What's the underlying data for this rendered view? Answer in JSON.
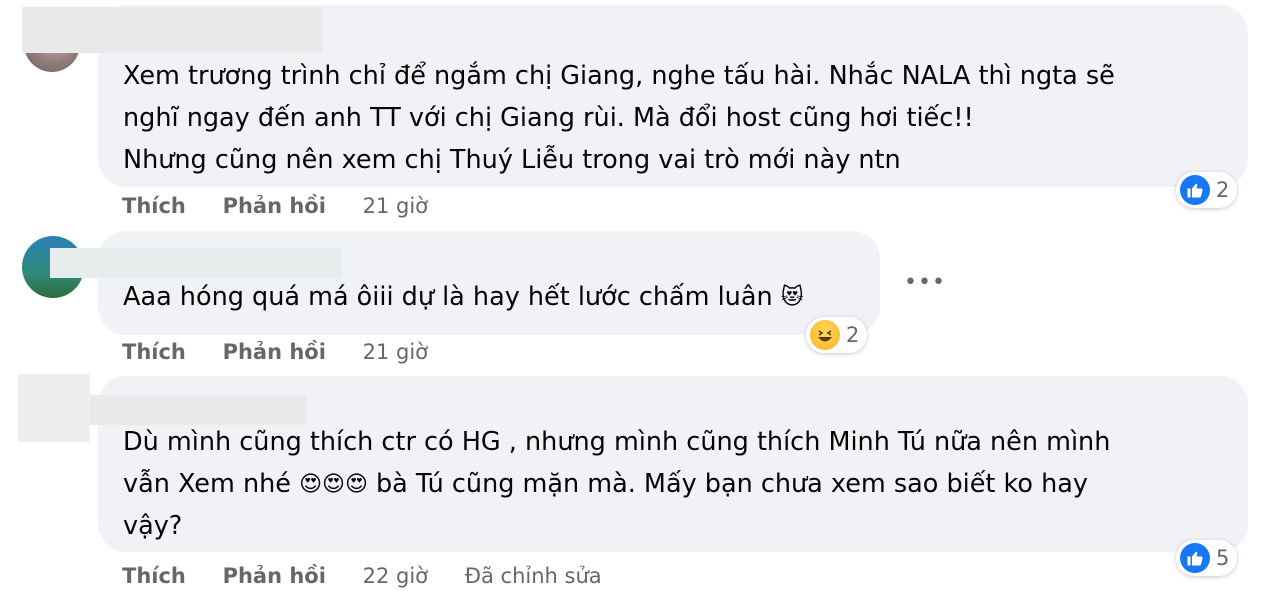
{
  "comments": [
    {
      "lines": [
        "Xem trương trình chỉ để ngắm chị Giang, nghe tấu hài. Nhắc NALA thì ngta sẽ",
        "nghĩ ngay đến anh TT với chị Giang rùi. Mà đổi host cũng hơi tiếc!!",
        "Nhưng cũng nên xem chị Thuý Liễu trong vai trò mới này ntn"
      ],
      "actions": {
        "like": "Thích",
        "reply": "Phản hồi",
        "time": "21 giờ"
      },
      "reaction": {
        "icon": "like-icon",
        "count": "2"
      }
    },
    {
      "lines": [
        "Aaa hóng quá má ôiii dự là hay hết lước chấm luân"
      ],
      "emoji": "😻",
      "actions": {
        "like": "Thích",
        "reply": "Phản hồi",
        "time": "21 giờ"
      },
      "reaction": {
        "icon": "haha-icon",
        "count": "2"
      },
      "more": "•••"
    },
    {
      "lines": [
        "Dù mình cũng thích ctr có HG , nhưng mình cũng thích Minh Tú nữa nên mình",
        "bà Tú cũng mặn mà. Mấy bạn chưa xem sao biết ko hay",
        "vậy?"
      ],
      "line2_prefix": "vẫn Xem nhé",
      "emoji_group": "😍😍😍",
      "actions": {
        "like": "Thích",
        "reply": "Phản hồi",
        "time": "22 giờ",
        "edited": "Đã chỉnh sửa"
      },
      "reaction": {
        "icon": "like-icon",
        "count": "5"
      }
    }
  ],
  "colors": {
    "bubble": "#f0f2f5",
    "meta_text": "#65676b",
    "like_blue": "#1877f2"
  }
}
